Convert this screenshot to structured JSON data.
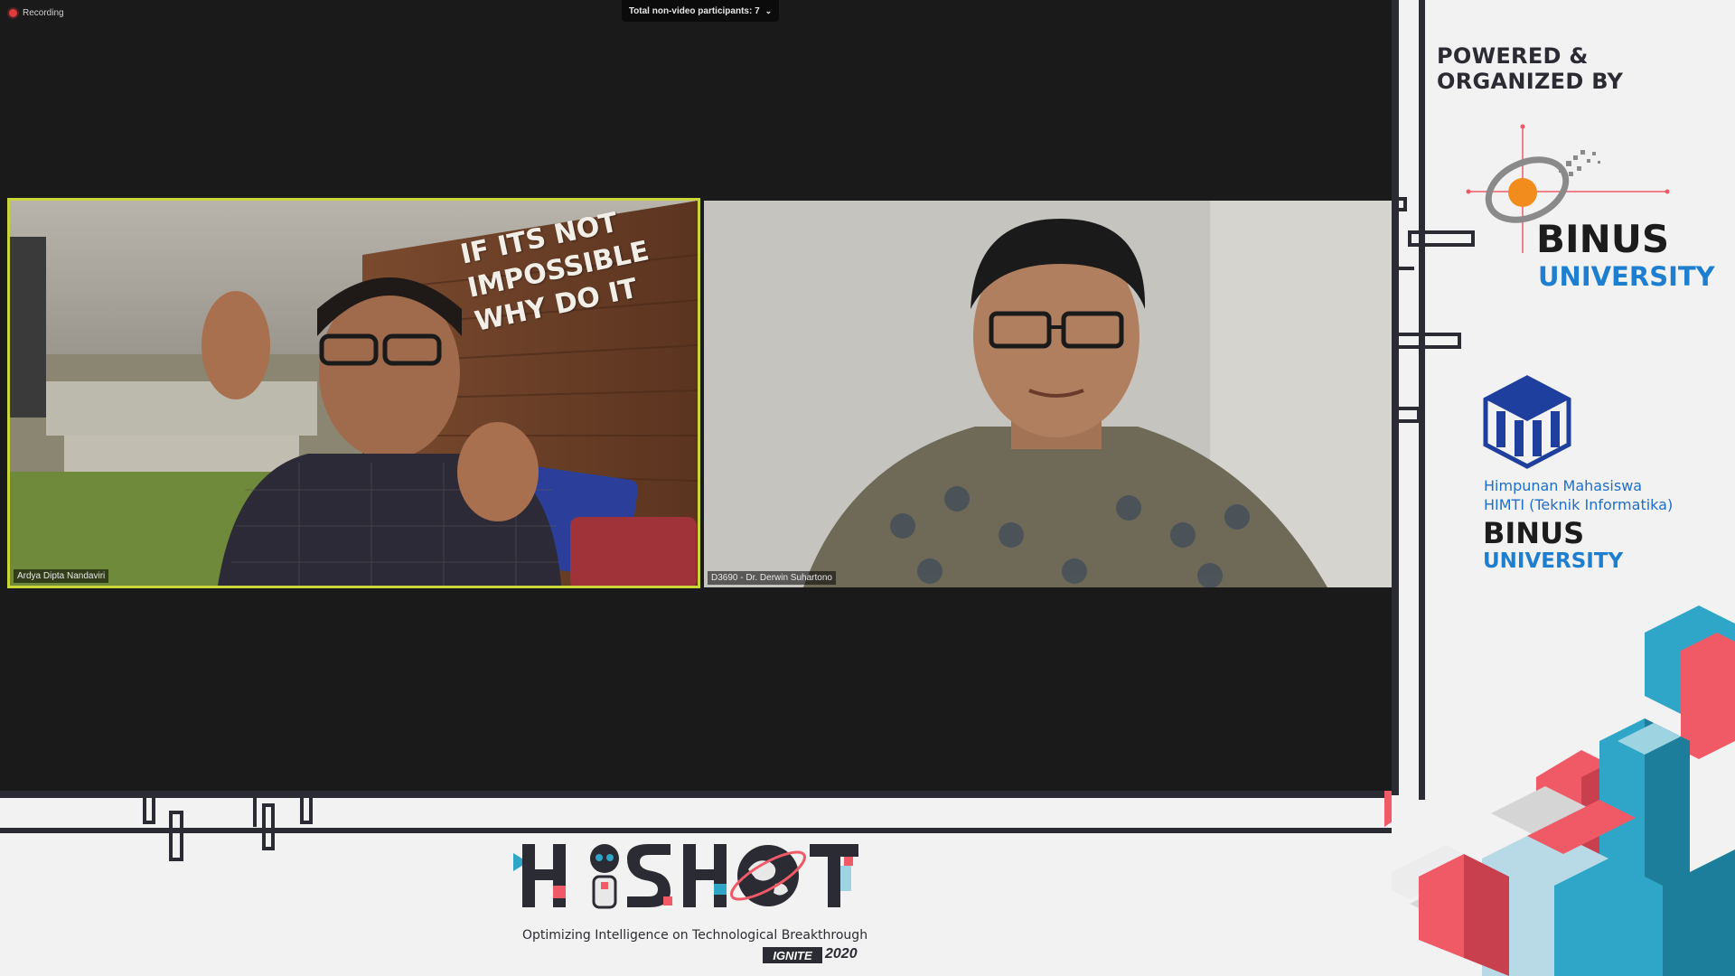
{
  "recording": {
    "label": "Recording"
  },
  "participants": {
    "label": "Total non-video participants: 7"
  },
  "tiles": [
    {
      "name": "Ardya Dipta Nandaviri",
      "wall_text": [
        "IF ITS NOT",
        "IMPOSSIBLE",
        "WHY DO IT"
      ]
    },
    {
      "name": "D3690 - Dr. Derwin Suhartono"
    }
  ],
  "sidebar": {
    "heading": "POWERED & ORGANIZED BY",
    "binus": {
      "word1": "BINUS",
      "word2": "UNIVERSITY"
    },
    "himti": {
      "line1": "Himpunan Mahasiswa",
      "line2": "HIMTI (Teknik Informatika)",
      "word1": "BINUS",
      "word2": "UNIVERSITY"
    }
  },
  "branding": {
    "logo_text": "HISHOT",
    "tagline": "Optimizing Intelligence on Technological Breakthrough",
    "ignite": "IGNITE",
    "year": "2020"
  },
  "colors": {
    "accent_red": "#f05a67",
    "accent_blue": "#2fa6c8",
    "dark": "#2b2b33",
    "active_border": "#c9d63a"
  }
}
